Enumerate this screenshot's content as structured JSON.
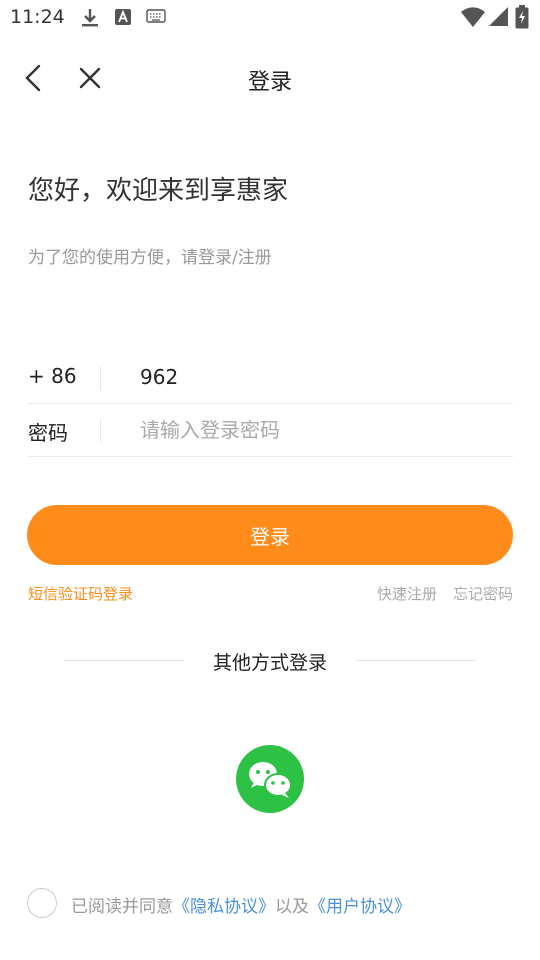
{
  "status_bar": {
    "time": "11:24",
    "icons": [
      "download-icon",
      "text-a-icon",
      "keyboard-icon",
      "wifi-icon",
      "cellular-icon",
      "battery-charging-icon"
    ]
  },
  "header": {
    "title": "登录",
    "back_icon": "chevron-left-icon",
    "close_icon": "close-icon"
  },
  "welcome": {
    "title": "您好，欢迎来到享惠家",
    "subtitle": "为了您的使用方便，请登录/注册"
  },
  "form": {
    "phone": {
      "prefix": "+ 86",
      "value": "962"
    },
    "password": {
      "label": "密码",
      "placeholder": "请输入登录密码"
    }
  },
  "actions": {
    "login_label": "登录",
    "sms_login": "短信验证码登录",
    "quick_register": "快速注册",
    "forgot_password": "忘记密码"
  },
  "other_login": {
    "title": "其他方式登录",
    "wechat_icon": "wechat-icon"
  },
  "agreement": {
    "prefix": "已阅读并同意",
    "privacy": "《隐私协议》",
    "middle": "以及",
    "user": "《用户协议》"
  },
  "colors": {
    "accent": "#ff8c1a",
    "link": "#4a90e2",
    "wechat": "#2dc145"
  }
}
